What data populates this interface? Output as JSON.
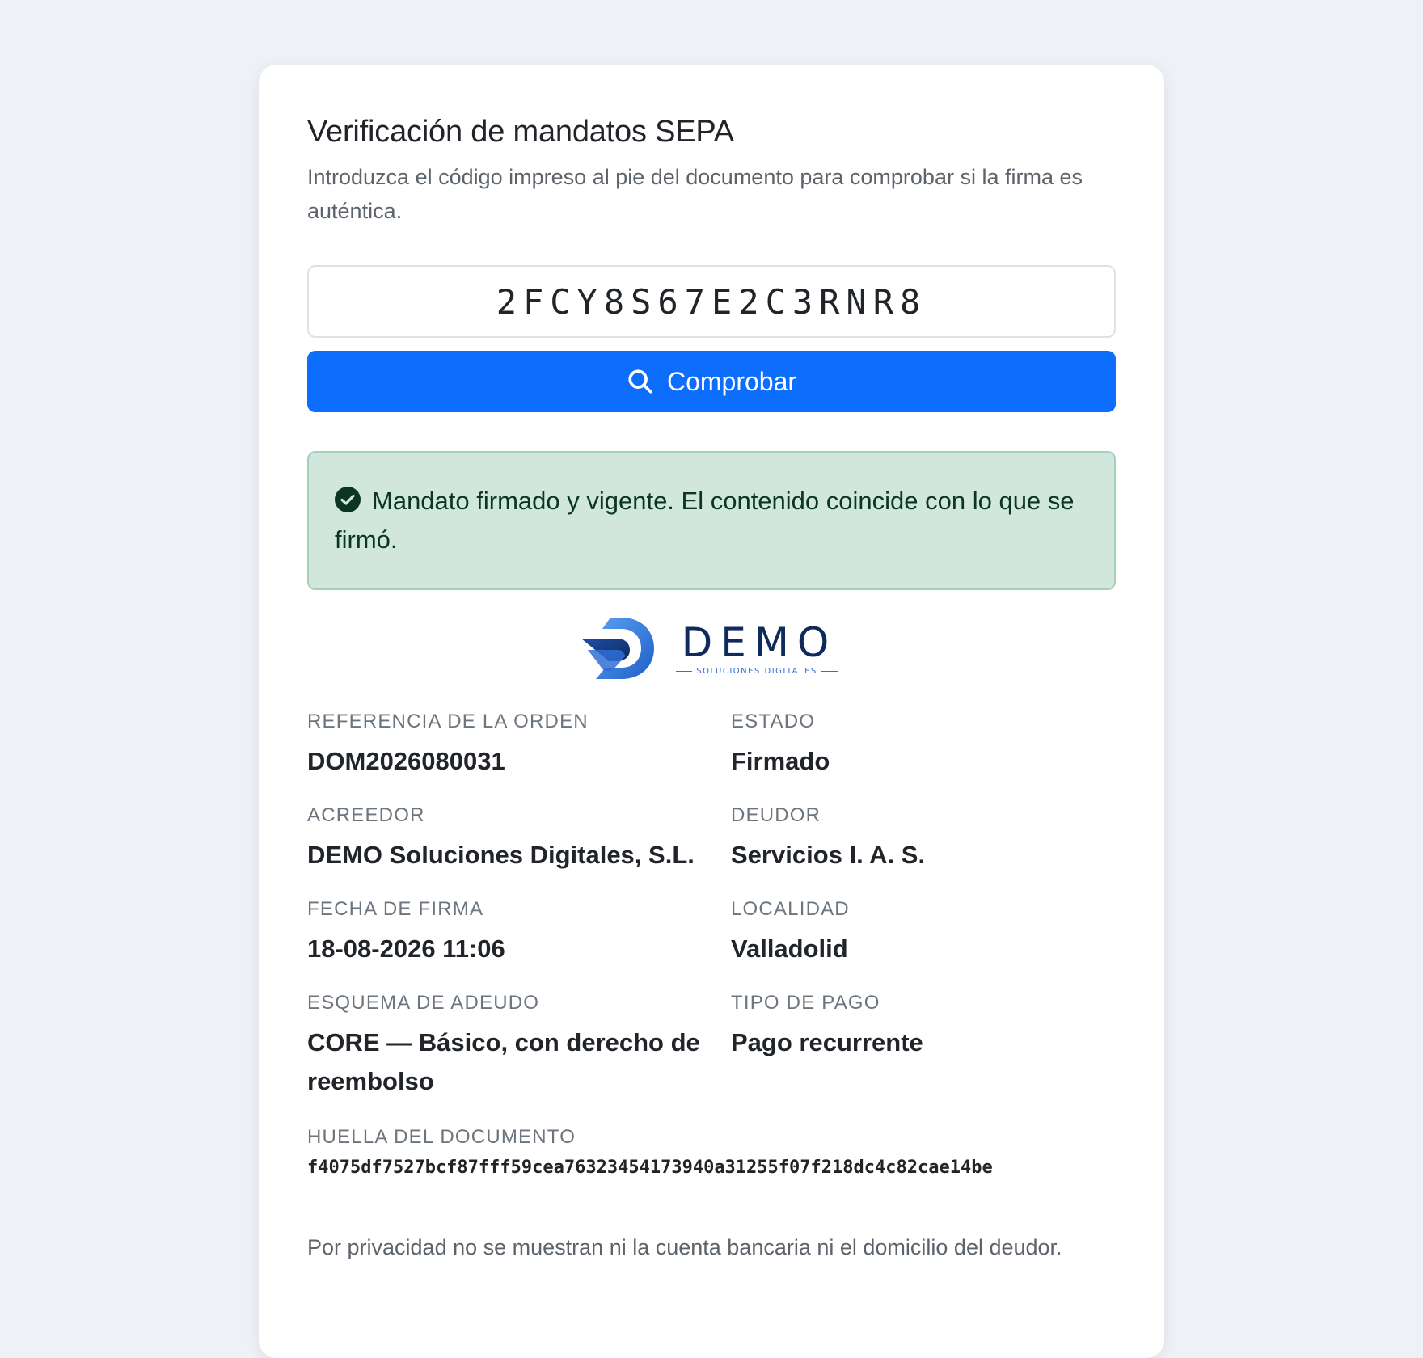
{
  "page": {
    "title": "Verificación de mandatos SEPA",
    "subtitle": "Introduzca el código impreso al pie del documento para comprobar si la firma es auténtica."
  },
  "form": {
    "code_value": "2FCY8S67E2C3RNR8",
    "submit_label": "Comprobar",
    "submit_icon": "search-icon"
  },
  "result": {
    "status": "success",
    "message": "Mandato firmado y vigente. El contenido coincide con lo que se firmó.",
    "icon": "check-circle-icon"
  },
  "logo": {
    "word": "DEMO",
    "tagline": "SOLUCIONES DIGITALES"
  },
  "details": [
    {
      "label": "REFERENCIA DE LA ORDEN",
      "value": "DOM2026080031"
    },
    {
      "label": "ESTADO",
      "value": "Firmado"
    },
    {
      "label": "ACREEDOR",
      "value": "DEMO Soluciones Digitales, S.L."
    },
    {
      "label": "DEUDOR",
      "value": "Servicios I. A. S."
    },
    {
      "label": "FECHA DE FIRMA",
      "value": "18-08-2026 11:06"
    },
    {
      "label": "LOCALIDAD",
      "value": "Valladolid"
    },
    {
      "label": "ESQUEMA DE ADEUDO",
      "value": "CORE — Básico, con derecho de reembolso"
    },
    {
      "label": "TIPO DE PAGO",
      "value": "Pago recurrente"
    }
  ],
  "fingerprint": {
    "label": "HUELLA DEL DOCUMENTO",
    "value": "f4075df7527bcf87fff59cea76323454173940a31255f07f218dc4c82cae14be"
  },
  "privacy_note": "Por privacidad no se muestran ni la cuenta bancaria ni el domicilio del deudor.",
  "colors": {
    "background": "#eef1f5",
    "primary": "#0d6efd",
    "success_bg": "#d1e7dd",
    "success_border": "#a3cfbb",
    "success_text": "#0a3622",
    "logo_navy": "#0f2a5c",
    "logo_blue": "#2f6fd6"
  }
}
